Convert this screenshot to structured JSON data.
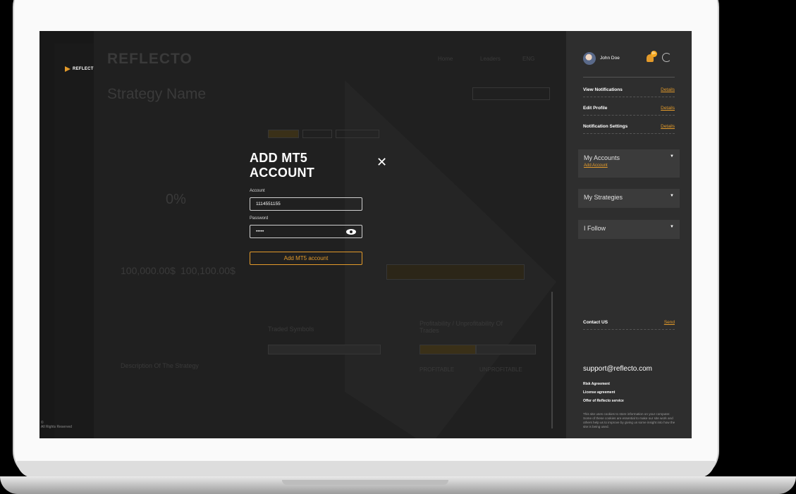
{
  "sidebar": {
    "logo_text": "REFLECTO",
    "rights": "©\nAll Rights Reserved"
  },
  "main": {
    "brand": "REFLECTO",
    "strategy_title": "Strategy Name",
    "nav": [
      "Home",
      "Leaders",
      "ENG"
    ],
    "stats": {
      "percent": "0%",
      "balance": "100,000.00$",
      "equity": "100,100.00$"
    },
    "traded_symbols": "Traded Symbols",
    "profitability": "Profitability / Unprofitability Of Trades",
    "profitable": "PROFITABLE",
    "unprofitable": "UNPROFITABLE",
    "description": "Description Of The Strategy"
  },
  "modal": {
    "title": "ADD MT5 ACCOUNT",
    "account_label": "Account",
    "account_value": "1114551155",
    "password_label": "Password",
    "password_value": "•••••",
    "submit_label": "Add MT5 account"
  },
  "panel": {
    "user_name": "John Doe",
    "badge_count": "9+",
    "menu": [
      {
        "label": "View Notifications",
        "link": "Details"
      },
      {
        "label": "Edit Profile",
        "link": "Details"
      },
      {
        "label": "Notification Settings",
        "link": "Details"
      }
    ],
    "accounts": {
      "label": "My Accounts",
      "sub": "Add Account"
    },
    "strategies": {
      "label": "My Strategies"
    },
    "follow": {
      "label": "I Follow"
    },
    "contact": {
      "label": "Contact US",
      "link": "Send"
    },
    "support_email": "support@reflecto.com",
    "legal": [
      "Risk Agreement",
      "License agreement",
      "Offer of Reflecto service"
    ],
    "cookie_text": "This site uses cookies to store information on your computer. Some of these cookies are essential to make our site work and others help us to improve by giving us some insight into how the site is being used."
  },
  "colors": {
    "accent": "#e39a2a",
    "panel": "#2e2e2e",
    "background": "#1f1f1f"
  }
}
